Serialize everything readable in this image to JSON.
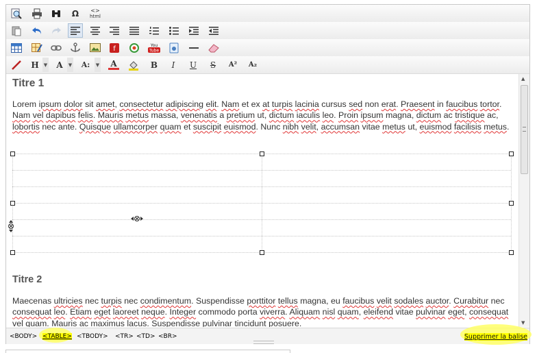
{
  "toolbar": {
    "row1": [
      "find-replace",
      "print",
      "search-binoculars",
      "special-characters",
      "html-source"
    ],
    "html_label": "html",
    "omega": "Ω",
    "row4": {
      "bold": "B",
      "italic": "I",
      "underline": "U",
      "strike": "S",
      "superscript": "A²",
      "subscript": "A₂",
      "heading": "H",
      "font_family": "A",
      "font_size": "A:",
      "font_color": "A"
    },
    "youtube_label": "You Tube"
  },
  "content": {
    "title1": "Titre 1",
    "para1_words": [
      "Lorem ",
      [
        "ipsum"
      ],
      " ",
      [
        "dolor"
      ],
      " sit ",
      [
        "amet"
      ],
      ", ",
      [
        "consectetur"
      ],
      " ",
      [
        "adipiscing"
      ],
      " ",
      [
        "elit"
      ],
      ". ",
      [
        "Nam"
      ],
      " et ex ",
      [
        "at"
      ],
      " ",
      [
        "turpis"
      ],
      " ",
      [
        "lacinia"
      ],
      " cursus ",
      [
        "sed"
      ],
      " non ",
      [
        "erat"
      ],
      ". ",
      [
        "Praesent"
      ],
      " in ",
      [
        "faucibus"
      ],
      " ",
      [
        "tortor"
      ],
      ". ",
      [
        "Nam"
      ],
      " ",
      [
        "vel"
      ],
      " ",
      [
        "dapibus"
      ],
      " ",
      [
        "felis"
      ],
      ". ",
      [
        "Mauris"
      ],
      " ",
      [
        "metus"
      ],
      " massa, ",
      [
        "venenatis"
      ],
      " a ",
      [
        "pretium"
      ],
      " ut, ",
      [
        "dictum"
      ],
      " ",
      [
        "iaculis"
      ],
      " ",
      [
        "leo"
      ],
      ". ",
      [
        "Proin"
      ],
      " ",
      [
        "ipsum"
      ],
      " magna, ",
      [
        "dictum"
      ],
      " ac ",
      [
        "tristique"
      ],
      " ac, ",
      [
        "lobortis"
      ],
      " nec ante. ",
      [
        "Quisque"
      ],
      " ",
      [
        "ullamcorper"
      ],
      " ",
      [
        "quam"
      ],
      " et ",
      [
        "suscipit"
      ],
      " ",
      [
        "euismod"
      ],
      ". Nunc ",
      [
        "nibh"
      ],
      " ",
      [
        "velit"
      ],
      ",",
      " ",
      [
        "accumsan"
      ],
      " vitae ",
      [
        "metus"
      ],
      " ut, ",
      [
        "euismod"
      ],
      " ",
      [
        "facilisis"
      ],
      " ",
      [
        "metus"
      ],
      "."
    ],
    "title2": "Titre 2",
    "para2_words": [
      "Maecenas ",
      [
        "ultricies"
      ],
      " nec ",
      [
        "turpis"
      ],
      " nec ",
      [
        "condimentum"
      ],
      ". Suspendisse ",
      [
        "porttitor"
      ],
      " ",
      [
        "tellus"
      ],
      " magna, eu ",
      [
        "faucibus"
      ],
      " ",
      [
        "velit"
      ],
      " ",
      [
        "sodales"
      ],
      " ",
      [
        "auctor"
      ],
      ". ",
      [
        "Curabitur"
      ],
      " nec ",
      [
        "consequat"
      ],
      " ",
      [
        "leo"
      ],
      ". ",
      [
        "Etiam"
      ],
      " ",
      [
        "eget"
      ],
      " ",
      [
        "laoreet"
      ],
      " ",
      [
        "neque"
      ],
      ". ",
      [
        "Integer"
      ],
      " commodo porta ",
      [
        "viverra"
      ],
      ". ",
      [
        "Aliquam"
      ],
      " ",
      [
        "nisl"
      ],
      " ",
      [
        "quam"
      ],
      ",",
      " ",
      [
        "eleifend"
      ],
      " vitae ",
      [
        "pulvinar"
      ],
      " ",
      [
        "eget"
      ],
      ", ",
      [
        "consequat"
      ],
      " ",
      [
        "vel"
      ],
      " ",
      [
        "quam"
      ],
      ". ",
      [
        "Mauris"
      ],
      " ac ",
      [
        "maximus"
      ],
      " ",
      [
        "lacus"
      ],
      ". Suspendisse ",
      [
        "pulvinar"
      ],
      " ",
      [
        "tincidunt"
      ],
      " ",
      [
        "posuere"
      ],
      "."
    ]
  },
  "statusbar": {
    "crumbs": [
      "<BODY>",
      "<TABLE>",
      "<TBODY>",
      "<TR>",
      "<TD>",
      "<BR>"
    ],
    "active_crumb": "<TABLE>",
    "remove_tag": "Supprimer la balise"
  },
  "colors": {
    "highlight": "#ffff00",
    "toolbar_bg": "#ececec",
    "active_btn": "#dfe8f4",
    "squiggle": "#e03333"
  }
}
